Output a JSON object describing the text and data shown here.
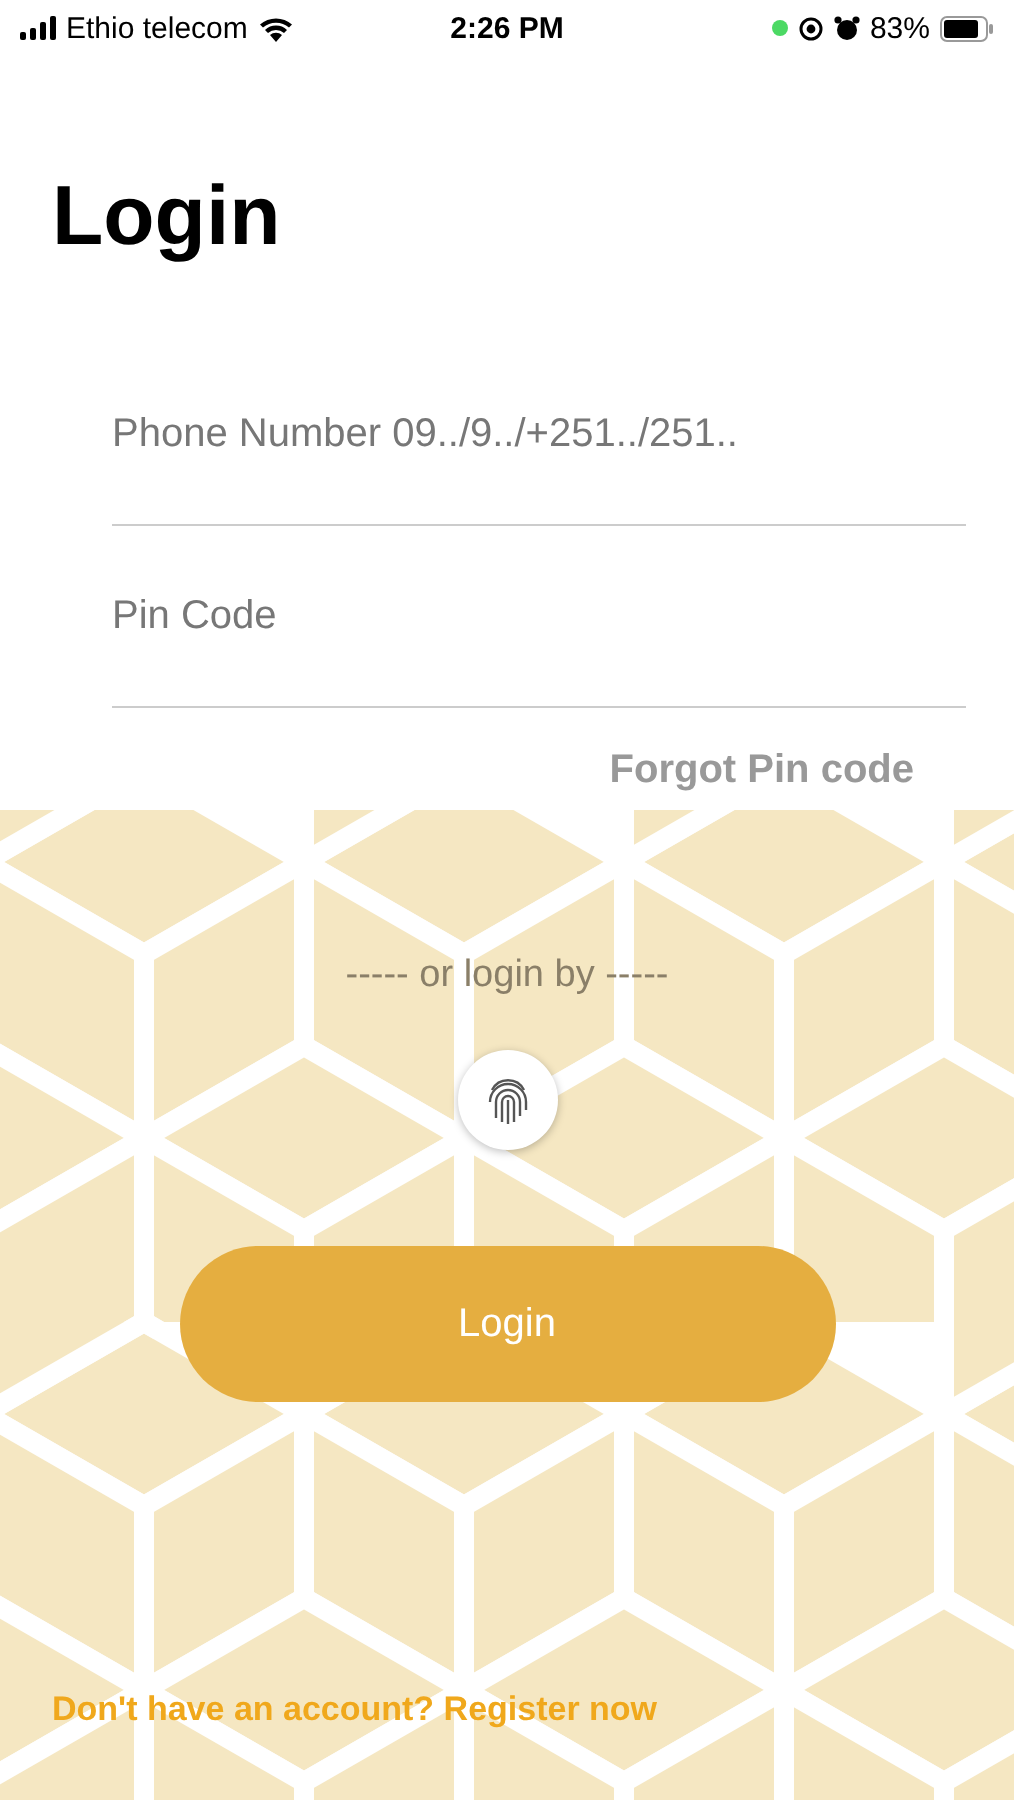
{
  "status_bar": {
    "carrier": "Ethio telecom",
    "time": "2:26 PM",
    "battery": "83%"
  },
  "title": "Login",
  "fields": [
    {
      "placeholder": "Phone Number 09../9../+251../251.."
    },
    {
      "placeholder": "Pin Code"
    }
  ],
  "forgot_link": "Forgot Pin code",
  "divider_text": "----- or login by -----",
  "login_button": "Login",
  "register_link": "Don't have an account? Register now"
}
